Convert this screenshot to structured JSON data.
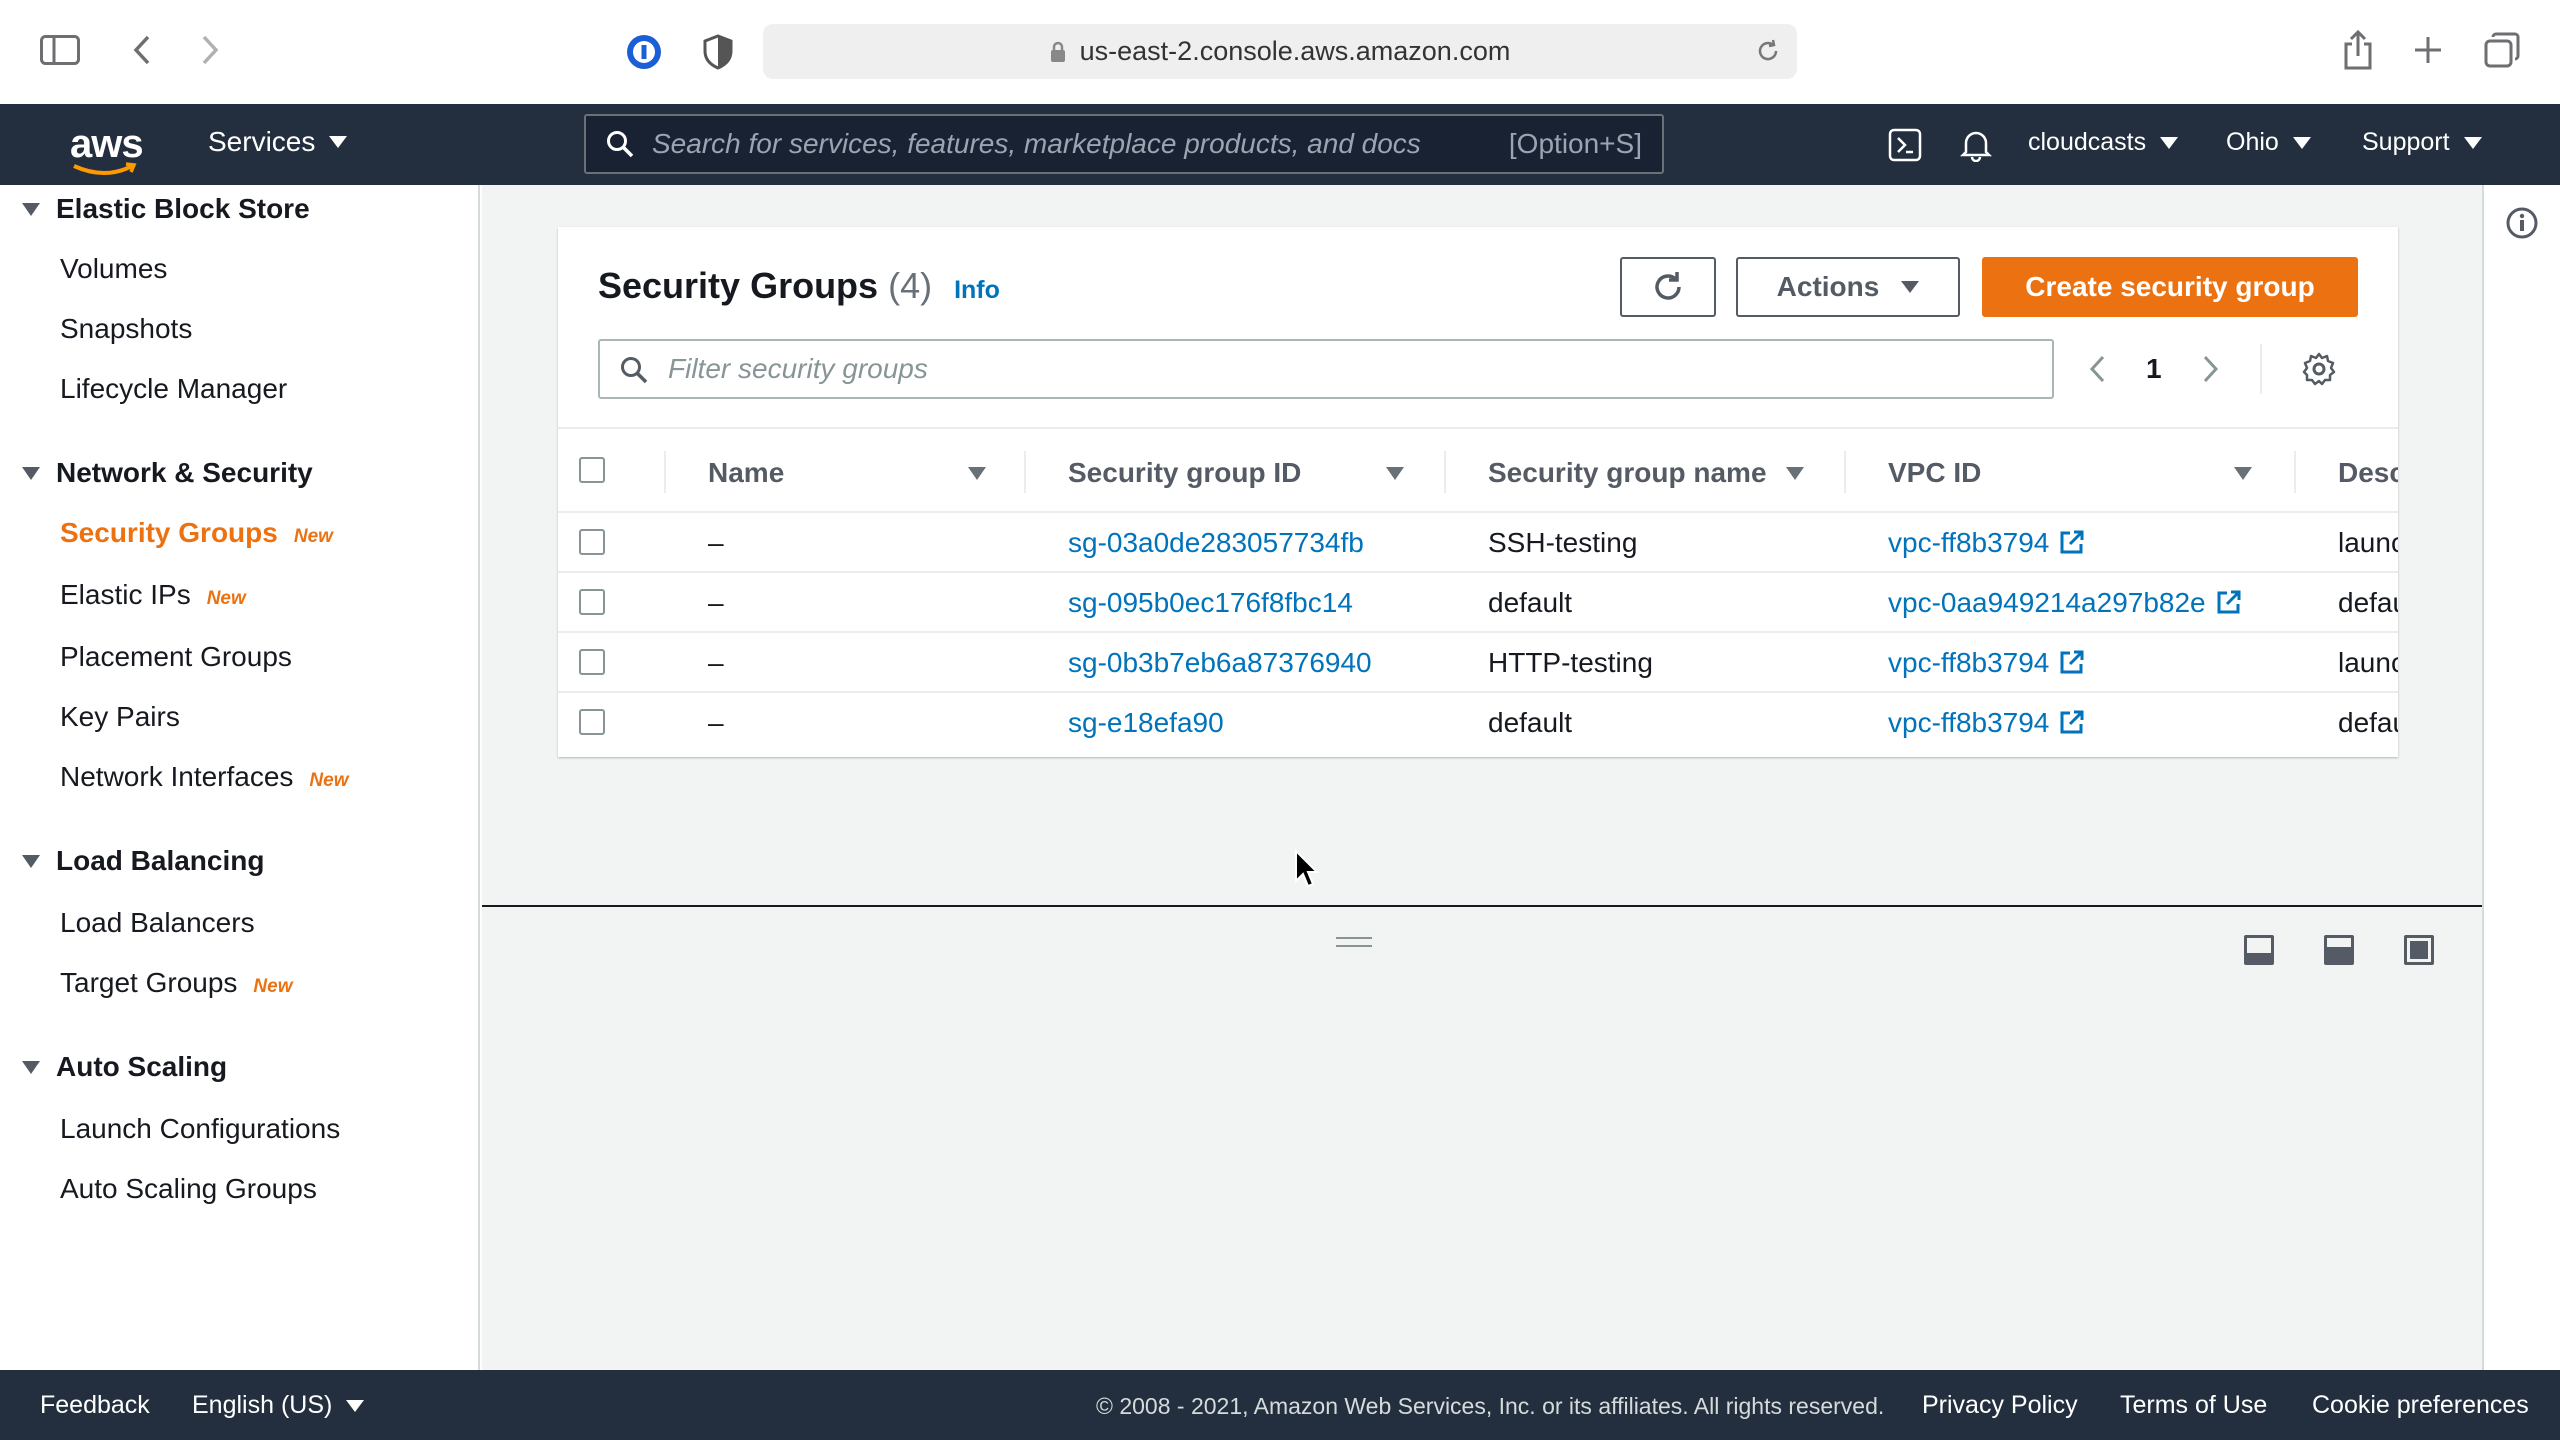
{
  "browser": {
    "url": "us-east-2.console.aws.amazon.com"
  },
  "awsnav": {
    "logo": "aws",
    "services_label": "Services",
    "search_placeholder": "Search for services, features, marketplace products, and docs",
    "search_hint": "[Option+S]",
    "account": "cloudcasts",
    "region": "Ohio",
    "support": "Support"
  },
  "sidebar": {
    "sections": [
      {
        "title": "Elastic Block Store",
        "items": [
          {
            "label": "Volumes",
            "badge": ""
          },
          {
            "label": "Snapshots",
            "badge": ""
          },
          {
            "label": "Lifecycle Manager",
            "badge": ""
          }
        ]
      },
      {
        "title": "Network & Security",
        "items": [
          {
            "label": "Security Groups",
            "badge": "New"
          },
          {
            "label": "Elastic IPs",
            "badge": "New"
          },
          {
            "label": "Placement Groups",
            "badge": ""
          },
          {
            "label": "Key Pairs",
            "badge": ""
          },
          {
            "label": "Network Interfaces",
            "badge": "New"
          }
        ]
      },
      {
        "title": "Load Balancing",
        "items": [
          {
            "label": "Load Balancers",
            "badge": ""
          },
          {
            "label": "Target Groups",
            "badge": "New"
          }
        ]
      },
      {
        "title": "Auto Scaling",
        "items": [
          {
            "label": "Launch Configurations",
            "badge": ""
          },
          {
            "label": "Auto Scaling Groups",
            "badge": ""
          }
        ]
      }
    ]
  },
  "panel": {
    "title": "Security Groups",
    "count": "(4)",
    "info": "Info",
    "actions_label": "Actions",
    "create_label": "Create security group",
    "filter_placeholder": "Filter security groups",
    "page": "1",
    "columns": [
      "Name",
      "Security group ID",
      "Security group name",
      "VPC ID",
      "Desc"
    ],
    "rows": [
      {
        "name": "–",
        "id": "sg-03a0de283057734fb",
        "group_name": "SSH-testing",
        "vpc": "vpc-ff8b3794",
        "desc": "launc"
      },
      {
        "name": "–",
        "id": "sg-095b0ec176f8fbc14",
        "group_name": "default",
        "vpc": "vpc-0aa949214a297b82e",
        "desc": "defau"
      },
      {
        "name": "–",
        "id": "sg-0b3b7eb6a87376940",
        "group_name": "HTTP-testing",
        "vpc": "vpc-ff8b3794",
        "desc": "launc"
      },
      {
        "name": "–",
        "id": "sg-e18efa90",
        "group_name": "default",
        "vpc": "vpc-ff8b3794",
        "desc": "defau"
      }
    ]
  },
  "footer": {
    "feedback": "Feedback",
    "language": "English (US)",
    "copyright": "© 2008 - 2021, Amazon Web Services, Inc. or its affiliates. All rights reserved.",
    "privacy": "Privacy Policy",
    "terms": "Terms of Use",
    "cookies": "Cookie preferences"
  },
  "colors": {
    "nav_bg": "#232f3e",
    "accent": "#ec7211",
    "link": "#0073bb"
  }
}
